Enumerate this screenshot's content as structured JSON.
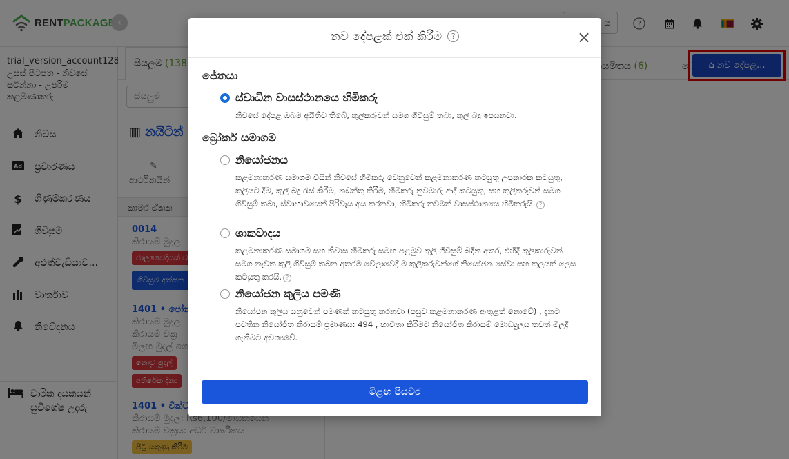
{
  "app": {
    "logo_a": "RENT",
    "logo_b": "PACKAGE",
    "lang_value": "ය",
    "flag": "🇱🇰"
  },
  "sidebar": {
    "account_name": "trial_version_account128",
    "account_role": "උසස් පිටපත - නිවසේ සිටින්නා - උපරිම කළමණාකරු",
    "items": [
      {
        "label": "නිවස",
        "icon": "home-icon"
      },
      {
        "label": "ප්‍රචාරණය",
        "icon": "ad-icon"
      },
      {
        "label": "ගිණුම්කරණය",
        "icon": "dollar-icon"
      },
      {
        "label": "ගිවිසුම",
        "icon": "contract-icon"
      },
      {
        "label": "අළුත්වැඩියාව...",
        "icon": "wrench-icon"
      },
      {
        "label": "වාර්තාව",
        "icon": "chart-icon"
      },
      {
        "label": "නිවේදනය",
        "icon": "bell-icon"
      }
    ],
    "bottom_item": "වාරික දායකයන් සුවිශේෂ උදරු"
  },
  "middle": {
    "tab_all": "සියලුම",
    "tab_all_count": "(138",
    "search_placeholder": "සියලුම",
    "property_title": "නයිටින් ස්ථානය",
    "sub_text": "ආර්ථිකයින්",
    "section_head": "කාමර ඒකක",
    "units": [
      {
        "no": "0014",
        "line1": "කිරායම් මුදල",
        "badge": "ජාලවෛදියක් ව",
        "badge2": "ගිවිසුම අත්සන"
      },
      {
        "no": "1401 • ජෝන්",
        "line1": "කිරායම් මුදල",
        "line2": "කිරායම් චක්‍ර",
        "line3": "මිලඟ මුදල් ගෙ",
        "badge": "නොවූ මුදල්",
        "badge2": "අතිරේක දින:"
      },
      {
        "no": "1401 • වික්ට",
        "line1": "කිරායම් මුදල: Rs6,100/මාසිකයෙන්",
        "line2": "කිරායම් චක්‍රය: අර්ධ වාර්ෂිකය",
        "badge": "පිටු යතුණු කිරීම"
      }
    ]
  },
  "right": {
    "tab_fixed": "නියමිතය",
    "tab_fixed_count": "(6)",
    "tab_more": "ෙ",
    "new_button": "නව දේපළ..."
  },
  "modal": {
    "title": "නව දේපළක් එක් කිරීම",
    "help": "?",
    "close": "×",
    "group1": "ජේතයා",
    "group2": "බ්‍රෝකර් සමාගම",
    "options": [
      {
        "title": "ස්වාධීන වාසස්ථානයෙ හිමිකරු",
        "desc": "නිවසේ දේපළ ඔබම අයිතිව තිබේ, කුලිකරුවන් සමග ගිවිසුම් තබා, කුලී බදු ඉපයනවා."
      },
      {
        "title": "නියෝජනය",
        "desc": "කළමනාකරණ සමාගම විසින් නිවසේ හිමිකරු වෙනුවෙන් කළමනාකරණ කටයුතු උපකාරක කටයුතු, කුලියට දීම, කුලී බදු රැස් කිරීම, නඩත්තු කිරීම, හිමිකරු නුවමාරු ආදී කටයුතු, සහ කුලිකරුවන් සමග ගිවිසුම් තබා, ස්වාභාවයෙන් පිරිවැය අය කරනවා, හිමිකරු තවමත් වාසස්ථානයෙ හිමිකරුයි."
      },
      {
        "title": "ශාකවාදය",
        "desc": "කළමනාකරණ සමාගම සහ නිවාස හිමිකරු සමඟ පළමුව කුලී ගිවිසුම් බඳින අතර, එහිදී කුලිකාරුවන් සමග නැවත කුලී ගිවිසුම් තබන අතරම වේලාවෙදී ම කුලිකරුවන්ගේ නියෝජන සේවා සහ කුලයක් ලෙස කටයුතු කරයි."
      },
      {
        "title": "නියෝජන කුලිය පමණි",
        "desc": "නියෝජන කුලිය යනුවෙන් පමණක් කටයුතු කරනවා (පසුව කළමනාකරණ ඇතුළත් නොවේ) , දැනට පවතින නියෝජිත කිරායම් ප්‍රමාණය: 494 , භාවිතා කිරීමට නියෝජිත කිරායම් මොඩ්‍යුලය තවත් මිලදී ගැනිමට අවශ්‍යවේ."
      }
    ],
    "next_button": "මීළඟ පියවර"
  }
}
